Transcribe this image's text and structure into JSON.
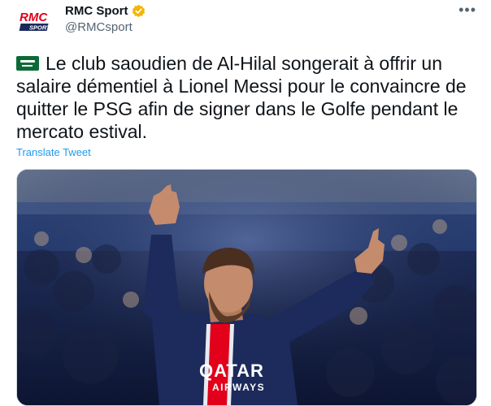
{
  "author": {
    "display_name": "RMC Sport",
    "handle": "@RMCsport",
    "avatar_text_top": "RMC",
    "avatar_text_bottom": "SPORT",
    "avatar_icon": "rmc-sport-logo"
  },
  "tweet": {
    "text": "Le club saoudien de Al-Hilal songerait à offrir un salaire démentiel à Lionel Messi pour le convaincre de quitter le PSG afin de signer dans le Golfe pendant le mercato estival.",
    "flag_icon": "saudi-arabia-flag",
    "translate_label": "Translate Tweet"
  },
  "more_label": "•••",
  "media": {
    "sponsor_top": "QATAR",
    "sponsor_bottom": "AIRWAYS"
  },
  "colors": {
    "link": "#1d9bf0",
    "verified": "#f4b400",
    "brand_red": "#e2001a",
    "jersey": "#1c2a5c"
  }
}
